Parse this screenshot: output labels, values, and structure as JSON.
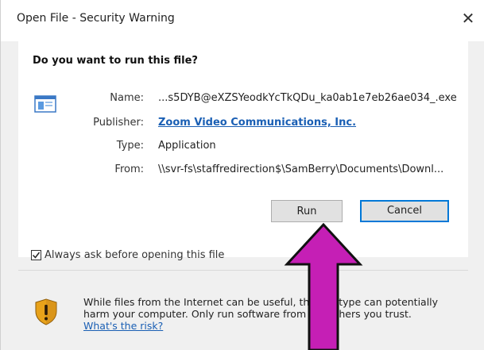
{
  "window": {
    "title": "Open File - Security Warning",
    "close_glyph": "✕"
  },
  "dialog": {
    "question": "Do you want to run this file?",
    "file_icon": "application-window-icon",
    "fields": {
      "name_label": "Name:",
      "name_value": "...s5DYB@eXZSYeodkYcTkQDu_ka0ab1e7eb26ae034_.exe",
      "publisher_label": "Publisher:",
      "publisher_value": "Zoom Video Communications, Inc.",
      "type_label": "Type:",
      "type_value": "Application",
      "from_label": "From:",
      "from_value": "\\\\svr-fs\\staffredirection$\\SamBerry\\Documents\\Downl..."
    },
    "buttons": {
      "run": "Run",
      "cancel": "Cancel"
    },
    "always_ask": {
      "label": "Always ask before opening this file",
      "checked": true
    },
    "warning": {
      "icon": "shield-warning-icon",
      "text_part1": "While files from the Internet can be useful, this file type can potentially harm your computer. Only run software from publishers you trust.",
      "link": "What's the risk?"
    }
  },
  "annotation": {
    "arrow_color": "#c51fb5",
    "arrow_direction": "up"
  },
  "colors": {
    "link": "#1a5fb4",
    "focus_border": "#0078d7"
  }
}
